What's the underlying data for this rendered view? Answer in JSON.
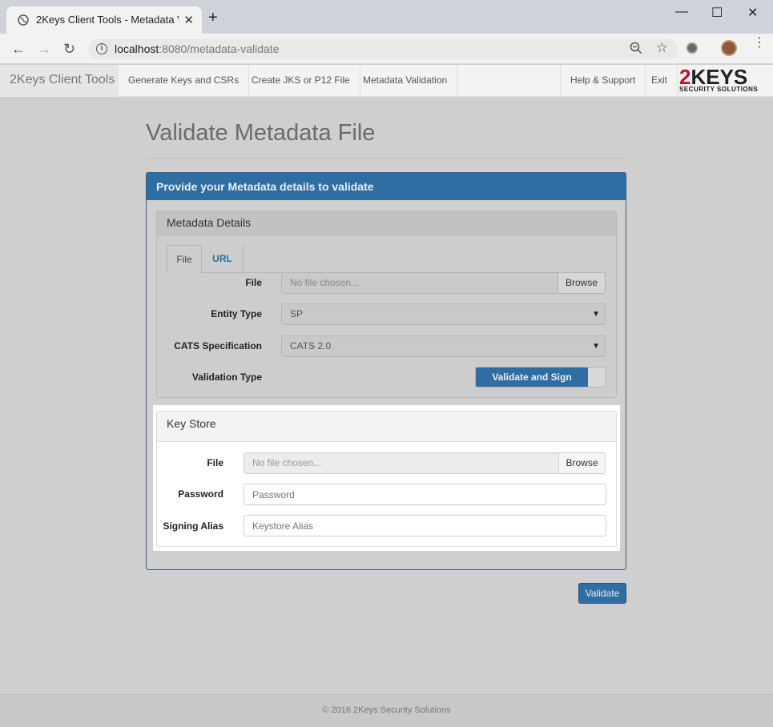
{
  "browser": {
    "tab_title": "2Keys Client Tools - Metadata Va",
    "new_tab": "+",
    "url_host": "localhost",
    "url_path": ":8080/metadata-validate",
    "min": "—",
    "max": "☐",
    "close": "✕",
    "tab_close": "✕"
  },
  "nav": {
    "brand": "2Keys Client Tools",
    "links": [
      "Generate Keys and CSRs",
      "Create JKS or P12 File",
      "Metadata Validation"
    ],
    "help": "Help & Support",
    "exit": "Exit",
    "logo_main": "KEYS",
    "logo_num": "2",
    "logo_sub": "SECURITY SOLUTIONS"
  },
  "page": {
    "title": "Validate Metadata File",
    "panel_heading": "Provide your Metadata details to validate"
  },
  "metadata": {
    "heading": "Metadata Details",
    "tabs": [
      "File",
      "URL"
    ],
    "file_label": "File",
    "file_value": "No file chosen...",
    "browse": "Browse",
    "entity_label": "Entity Type",
    "entity_value": "SP",
    "cats_label": "CATS Specification",
    "cats_value": "CATS 2.0",
    "validation_label": "Validation Type",
    "validation_value": "Validate and Sign"
  },
  "keystore": {
    "heading": "Key Store",
    "file_label": "File",
    "file_value": "No file chosen...",
    "browse": "Browse",
    "password_label": "Password",
    "password_placeholder": "Password",
    "alias_label": "Signing Alias",
    "alias_placeholder": "Keystore Alias"
  },
  "actions": {
    "validate": "Validate"
  },
  "footer": {
    "text": "© 2016 2Keys Security Solutions"
  }
}
